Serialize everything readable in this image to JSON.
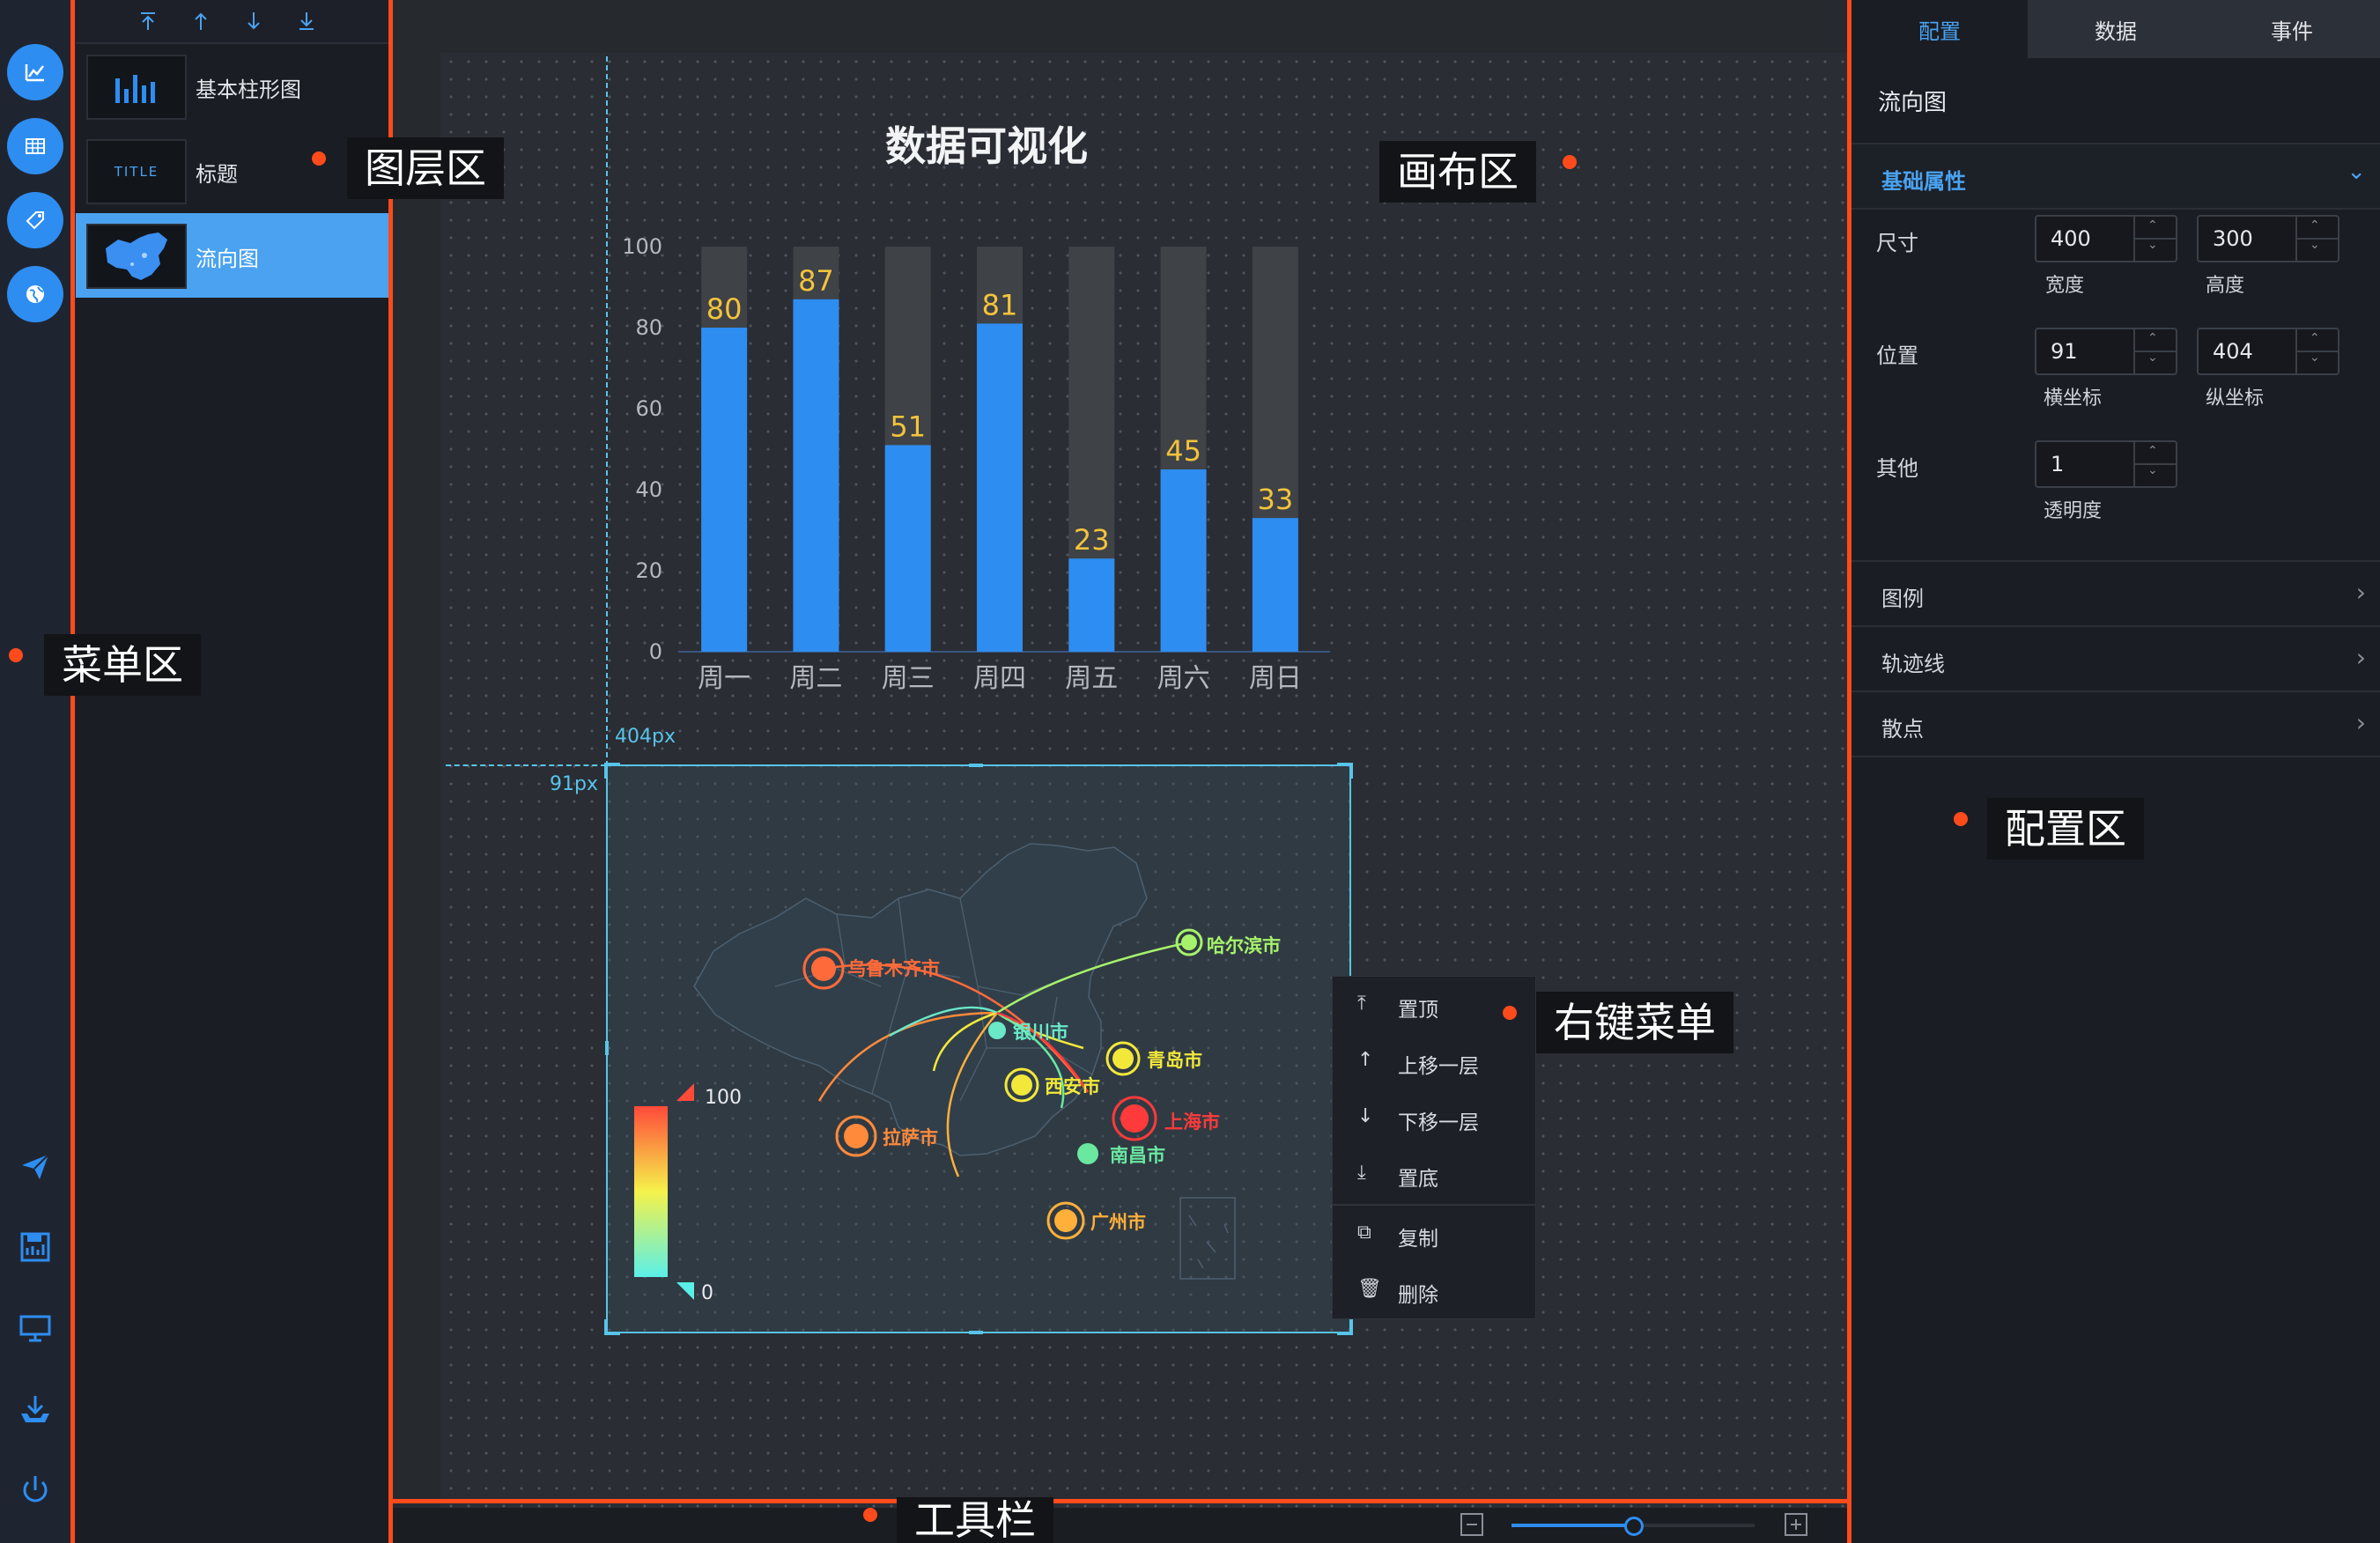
{
  "menu": {
    "items": [
      {
        "icon": "line-chart-icon"
      },
      {
        "icon": "table-icon"
      },
      {
        "icon": "tag-icon"
      },
      {
        "icon": "globe-icon"
      }
    ],
    "tools": [
      {
        "icon": "send-icon"
      },
      {
        "icon": "save-icon"
      },
      {
        "icon": "monitor-icon"
      },
      {
        "icon": "download-icon"
      },
      {
        "icon": "power-icon"
      }
    ]
  },
  "layers": {
    "toolbar_icons": [
      "move-top-icon",
      "move-up-icon",
      "move-down-icon",
      "move-bottom-icon"
    ],
    "items": [
      {
        "label": "基本柱形图",
        "thumb": "bar-chart-thumb"
      },
      {
        "label": "标题",
        "thumb_text": "TITLE"
      },
      {
        "label": "流向图",
        "thumb": "china-map-thumb",
        "active": true
      }
    ]
  },
  "canvas": {
    "chart_title": "数据可视化",
    "guide_x_label": "404px",
    "guide_y_label": "91px"
  },
  "chart_data": {
    "type": "bar",
    "title": "数据可视化",
    "categories": [
      "周一",
      "周二",
      "周三",
      "周四",
      "周五",
      "周六",
      "周日"
    ],
    "values": [
      80,
      87,
      51,
      81,
      23,
      45,
      33
    ],
    "background_max": 100,
    "yticks": [
      "0",
      "20",
      "40",
      "60",
      "80",
      "100"
    ],
    "ylim": [
      0,
      100
    ],
    "colors": {
      "bar": "#2e8df1",
      "bar_bg": "#3f4246",
      "label": "#f3c33c"
    }
  },
  "map": {
    "legend_max": "100",
    "legend_min": "0",
    "cities": [
      {
        "name": "乌鲁木齐市",
        "color": "#ff6a3a"
      },
      {
        "name": "哈尔滨市",
        "color": "#a6f26a"
      },
      {
        "name": "银川市",
        "color": "#6ae8c8"
      },
      {
        "name": "青岛市",
        "color": "#f2e83a"
      },
      {
        "name": "西安市",
        "color": "#f2e83a"
      },
      {
        "name": "上海市",
        "color": "#ff3a3a"
      },
      {
        "name": "拉萨市",
        "color": "#ff8a3a"
      },
      {
        "name": "南昌市",
        "color": "#6ae8a0"
      },
      {
        "name": "广州市",
        "color": "#ffb03a"
      }
    ]
  },
  "context_menu": {
    "items": [
      {
        "label": "置顶",
        "icon": "move-top-icon"
      },
      {
        "label": "上移一层",
        "icon": "move-up-icon"
      },
      {
        "label": "下移一层",
        "icon": "move-down-icon"
      },
      {
        "label": "置底",
        "icon": "move-bottom-icon"
      },
      {
        "label": "复制",
        "icon": "copy-icon"
      },
      {
        "label": "删除",
        "icon": "trash-icon"
      }
    ]
  },
  "config": {
    "tabs": [
      {
        "label": "配置",
        "active": true
      },
      {
        "label": "数据"
      },
      {
        "label": "事件"
      }
    ],
    "component_name": "流向图",
    "section_basic": "基础属性",
    "size_label": "尺寸",
    "width_value": "400",
    "width_label": "宽度",
    "height_value": "300",
    "height_label": "高度",
    "position_label": "位置",
    "x_value": "91",
    "x_label": "横坐标",
    "y_value": "404",
    "y_label": "纵坐标",
    "other_label": "其他",
    "opacity_value": "1",
    "opacity_label": "透明度",
    "collapsed_sections": [
      "图例",
      "轨迹线",
      "散点"
    ]
  },
  "toolbar": {
    "zoom_level": 0.5
  },
  "annotations": {
    "layer_area": "图层区",
    "canvas_area": "画布区",
    "menu_area": "菜单区",
    "config_area": "配置区",
    "context_menu": "右键菜单",
    "toolbar": "工具栏"
  },
  "colors": {
    "accent": "#2e8df1",
    "highlight": "#4aa2f0",
    "annotation_line": "#ff4a1c"
  }
}
